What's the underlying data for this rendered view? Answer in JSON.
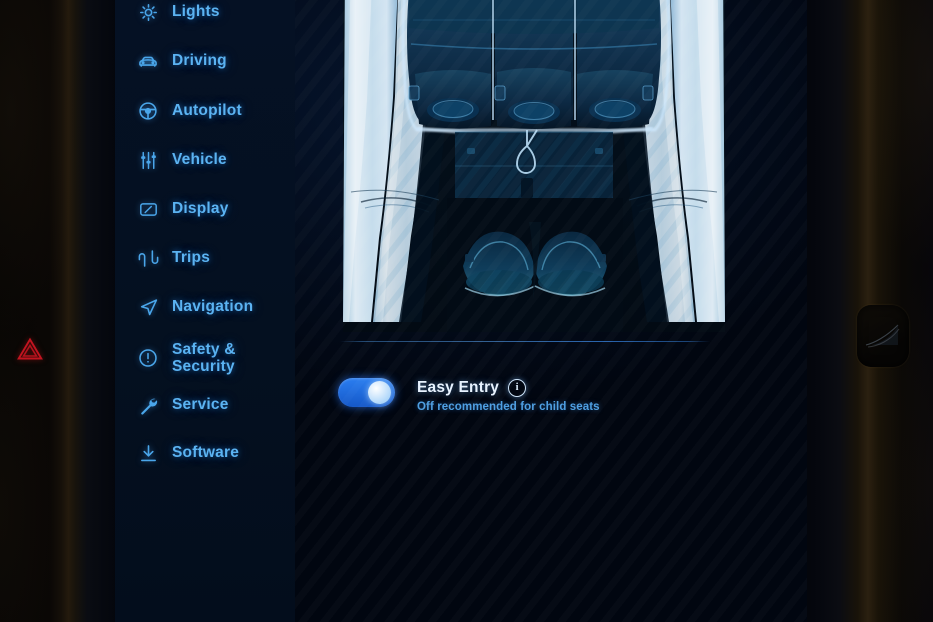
{
  "screen": {
    "accent_blue": "#2b7ef0",
    "label_blue": "#5bb3f2",
    "sidebar_bg": "#051124",
    "content_bg": "#010610"
  },
  "sidebar": {
    "items": [
      {
        "id": "lights",
        "label": "Lights",
        "icon": "lights-icon"
      },
      {
        "id": "driving",
        "label": "Driving",
        "icon": "car-icon"
      },
      {
        "id": "autopilot",
        "label": "Autopilot",
        "icon": "steering-wheel-icon"
      },
      {
        "id": "vehicle",
        "label": "Vehicle",
        "icon": "sliders-icon"
      },
      {
        "id": "display",
        "label": "Display",
        "icon": "display-icon"
      },
      {
        "id": "trips",
        "label": "Trips",
        "icon": "winding-road-icon"
      },
      {
        "id": "navigation",
        "label": "Navigation",
        "icon": "navigation-arrow-icon"
      },
      {
        "id": "safety-security",
        "label": "Safety &\nSecurity",
        "icon": "alert-circle-icon"
      },
      {
        "id": "service",
        "label": "Service",
        "icon": "wrench-icon"
      },
      {
        "id": "software",
        "label": "Software",
        "icon": "download-icon"
      }
    ]
  },
  "main": {
    "seat_view": {
      "name": "rear-seats-top-down-illustration",
      "description": "Top-down illustration of vehicle rear bench seats and front seat headrests"
    },
    "easy_entry": {
      "title": "Easy Entry",
      "subtitle": "Off recommended for child seats",
      "info_glyph": "i",
      "toggle_state": "on"
    }
  },
  "dashboard": {
    "hazard_button": {
      "name": "hazard-lights-button",
      "glyph": "warning-triangle"
    },
    "right_trim": {
      "name": "passenger-dash-vent"
    }
  }
}
